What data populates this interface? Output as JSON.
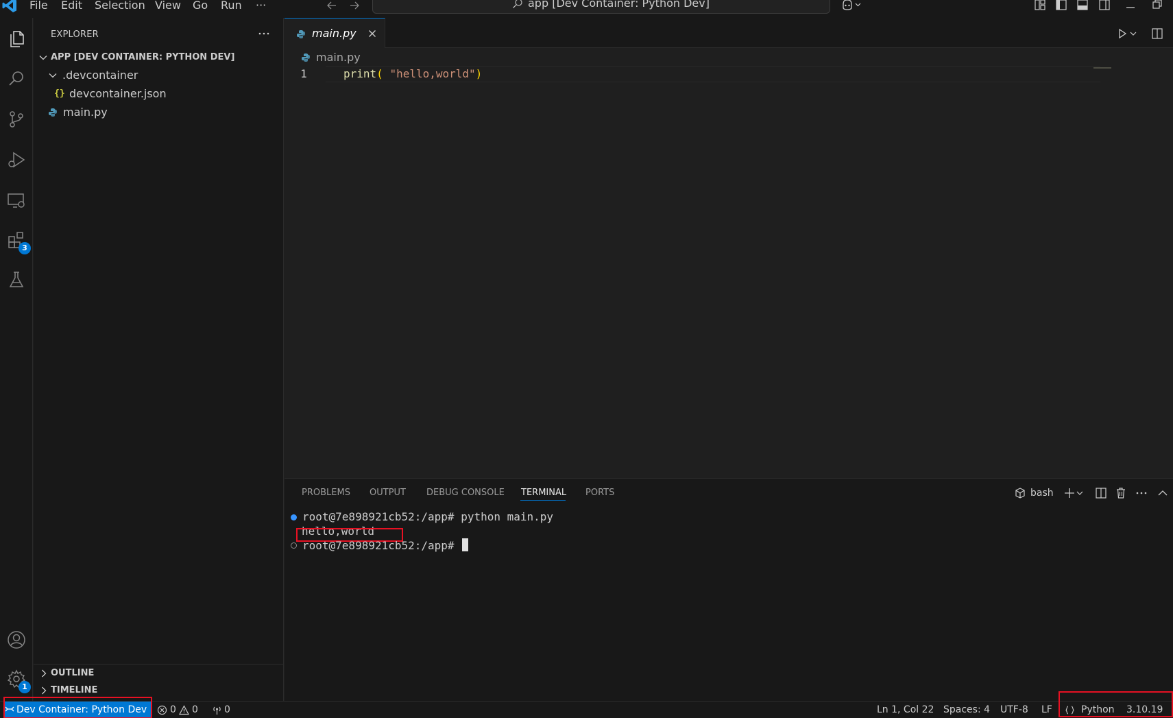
{
  "titlebar": {
    "menu": [
      "File",
      "Edit",
      "Selection",
      "View",
      "Go",
      "Run",
      "···"
    ],
    "command_center": "app [Dev Container: Python Dev]"
  },
  "activitybar": {
    "extensions_badge": "3",
    "settings_badge": "1"
  },
  "sidebar": {
    "title": "EXPLORER",
    "root_folder": "APP [DEV CONTAINER: PYTHON DEV]",
    "tree": {
      "devcontainer_folder": ".devcontainer",
      "devcontainer_json": "devcontainer.json",
      "main_py": "main.py"
    },
    "json_icon_glyph": "{}",
    "outline": "OUTLINE",
    "timeline": "TIMELINE"
  },
  "editor": {
    "tab_label": "main.py",
    "breadcrumb": "main.py",
    "line_number": "1",
    "code": {
      "fn": "print",
      "open_paren": "( ",
      "string": "\"hello,world\"",
      "close_paren": ")"
    }
  },
  "panel": {
    "tabs": [
      "PROBLEMS",
      "OUTPUT",
      "DEBUG CONSOLE",
      "TERMINAL",
      "PORTS"
    ],
    "active_tab": "TERMINAL",
    "shell": "bash",
    "terminal": {
      "line1": "root@7e898921cb52:/app# python main.py",
      "line2": "hello,world",
      "line3": "root@7e898921cb52:/app# "
    }
  },
  "statusbar": {
    "remote": "Dev Container: Python Dev",
    "errors": "0",
    "warnings": "0",
    "ports": "0",
    "position": "Ln 1, Col 22",
    "spaces": "Spaces: 4",
    "encoding": "UTF-8",
    "eol": "LF",
    "language": "Python",
    "python_version": "3.10.19"
  },
  "colors": {
    "accent": "#0078d4",
    "highlight_box": "#e81123",
    "python_icon": "#519aba",
    "json_icon": "#cbcb41"
  },
  "icons": {
    "activitybar": [
      "files-icon",
      "search-icon",
      "source-control-icon",
      "run-debug-icon",
      "remote-explorer-icon",
      "extensions-icon",
      "testing-icon",
      "account-icon",
      "settings-gear-icon"
    ]
  }
}
